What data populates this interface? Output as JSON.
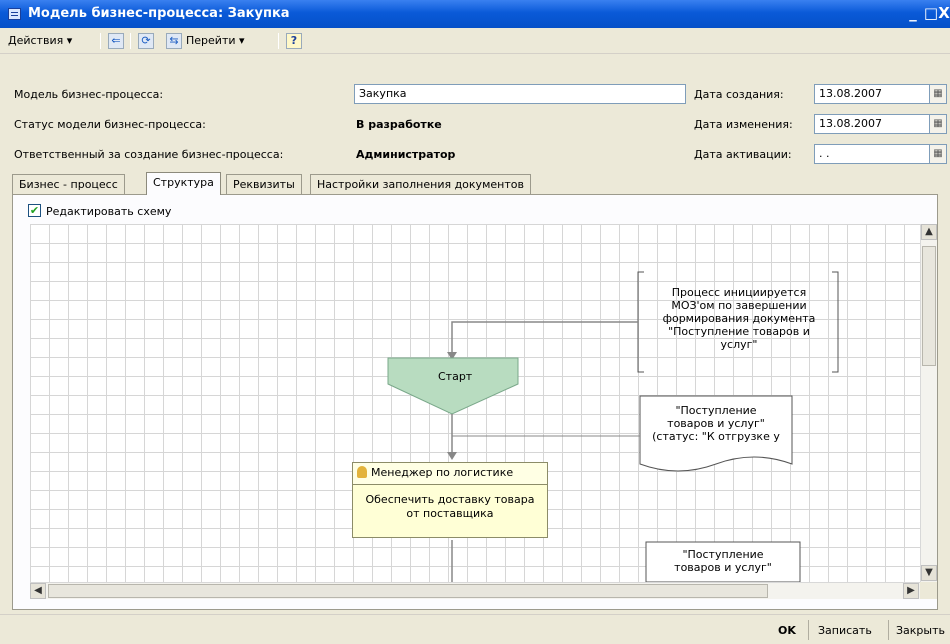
{
  "window": {
    "title": "Модель бизнес-процесса: Закупка",
    "minimize": "_",
    "maximize": "□",
    "close": "X"
  },
  "toolbar": {
    "actions": "Действия",
    "goto": "Перейти",
    "help": "?"
  },
  "form": {
    "model_label": "Модель бизнес-процесса:",
    "model_value": "Закупка",
    "status_label": "Статус модели бизнес-процесса:",
    "status_value": "В разработке",
    "responsible_label": "Ответственный за создание бизнес-процесса:",
    "responsible_value": "Администратор",
    "created_label": "Дата создания:",
    "created_value": "13.08.2007",
    "modified_label": "Дата изменения:",
    "modified_value": "13.08.2007",
    "activated_label": "Дата активации:",
    "activated_value": ". ."
  },
  "tabs": [
    {
      "label": "Бизнес - процесс"
    },
    {
      "label": "Структура"
    },
    {
      "label": "Реквизиты"
    },
    {
      "label": "Настройки заполнения документов"
    }
  ],
  "edit_scheme": {
    "label": "Редактировать схему",
    "checked": true
  },
  "diagram": {
    "note1": [
      "Процесс инициируется",
      "МОЗ'ом по завершении",
      "формирования документа",
      "\"Поступление товаров и",
      "услуг\""
    ],
    "start": "Старт",
    "note2": [
      "\"Поступление",
      "товаров и услуг\"",
      "(статус: \"К отгрузке у"
    ],
    "task_role": "Менеджер по логистике",
    "task_text": [
      "Обеспечить доставку товара",
      "от поставщика"
    ],
    "note3": [
      "\"Поступление",
      "товаров и услуг\""
    ]
  },
  "buttons": {
    "ok": "OK",
    "save": "Записать",
    "close": "Закрыть"
  }
}
